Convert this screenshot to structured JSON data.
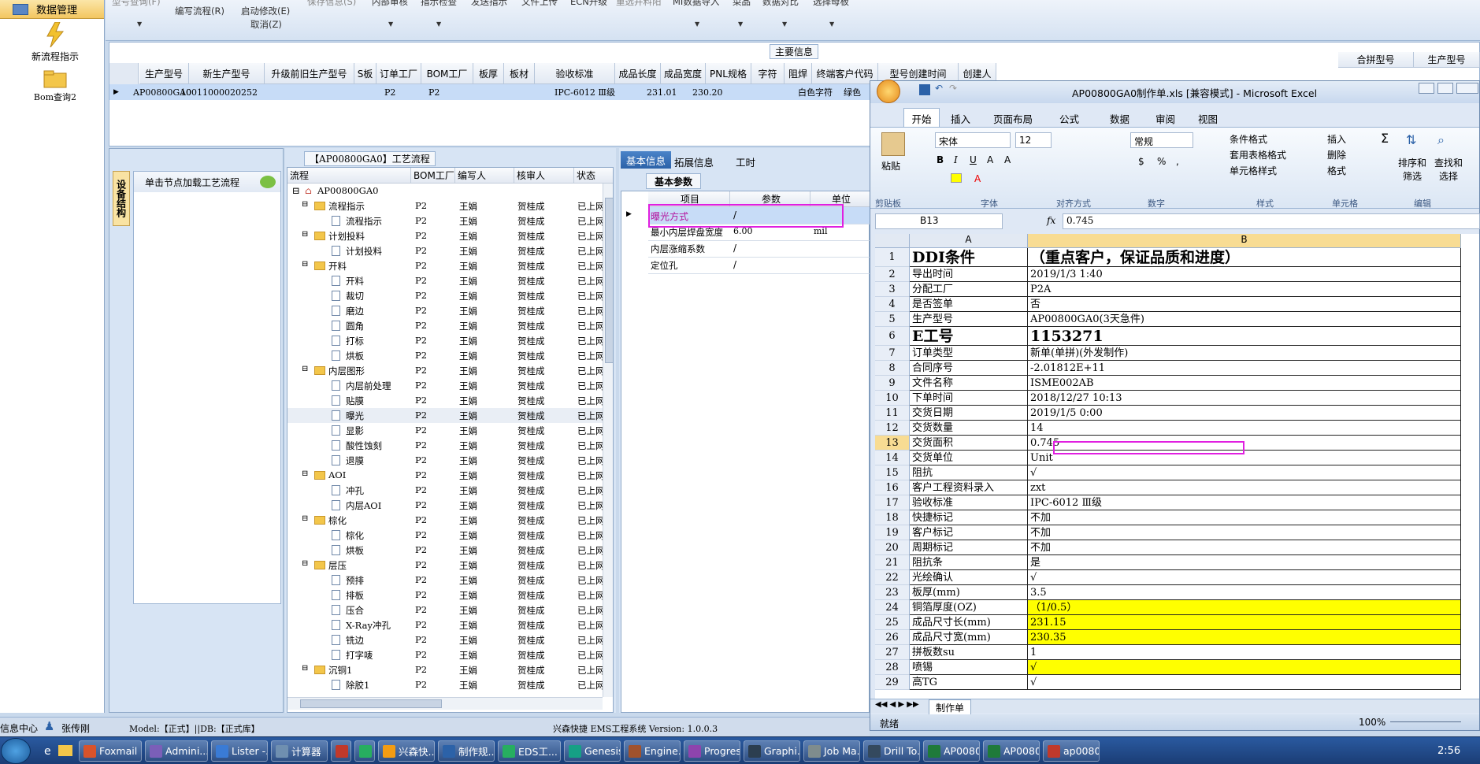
{
  "sidebar": {
    "header": "数据管理",
    "new_flow": "新流程指示",
    "bom_query": "Bom查询2"
  },
  "toolbar": {
    "model_query": "型号查询(F)",
    "edit_flow": "编写流程(R)",
    "start_modify": "启动修改(E)",
    "cancel": "取消(Z)",
    "save_info": "保存信息(S)",
    "internal_review": "内部审核",
    "instruction_check": "指示检查",
    "send_instruction": "发送指示",
    "file_upload": "文件上传",
    "ecn_upgrade": "ECN升级",
    "redo_merge": "重选并料阳",
    "mi_export": "MI数据导入",
    "set_tool": "菜品",
    "data_compare": "数据对比",
    "select_board": "选择母板"
  },
  "main_info": {
    "title": "主要信息",
    "columns": [
      "生产型号",
      "新生产型号",
      "升级前旧生产型号",
      "S板",
      "订单工厂",
      "BOM工厂",
      "板厚",
      "板材",
      "验收标准",
      "成品长度",
      "成品宽度",
      "PNL规格",
      "字符",
      "阻焊",
      "终端客户代码",
      "型号创建时间",
      "创建人"
    ],
    "extra_columns": [
      "合拼型号",
      "生产型号"
    ],
    "row": {
      "model": "AP00800GA0",
      "new_model": "10011000020252",
      "order_factory": "P2",
      "bom_factory": "P2",
      "standard": "IPC-6012 Ⅲ级",
      "length": "231.01",
      "width": "230.20",
      "char": "白色字符",
      "solder": "绿色"
    }
  },
  "left_panel": {
    "vertical_tab": "设备结构",
    "button": "单击节点加载工艺流程"
  },
  "process": {
    "title": "【AP00800GA0】工艺流程",
    "columns": [
      "流程",
      "BOM工厂",
      "编写人",
      "核审人",
      "状态"
    ],
    "root": "AP00800GA0",
    "rows": [
      {
        "name": "流程指示",
        "type": "folder",
        "f": "P2",
        "w": "王娟",
        "r": "贺桂成",
        "s": "已上网"
      },
      {
        "name": "流程指示",
        "type": "doc",
        "f": "P2",
        "w": "王娟",
        "r": "贺桂成",
        "s": "已上网"
      },
      {
        "name": "计划投料",
        "type": "folder",
        "f": "P2",
        "w": "王娟",
        "r": "贺桂成",
        "s": "已上网"
      },
      {
        "name": "计划投料",
        "type": "doc",
        "f": "P2",
        "w": "王娟",
        "r": "贺桂成",
        "s": "已上网"
      },
      {
        "name": "开料",
        "type": "folder",
        "f": "P2",
        "w": "王娟",
        "r": "贺桂成",
        "s": "已上网"
      },
      {
        "name": "开料",
        "type": "doc",
        "f": "P2",
        "w": "王娟",
        "r": "贺桂成",
        "s": "已上网"
      },
      {
        "name": "裁切",
        "type": "doc",
        "f": "P2",
        "w": "王娟",
        "r": "贺桂成",
        "s": "已上网"
      },
      {
        "name": "磨边",
        "type": "doc",
        "f": "P2",
        "w": "王娟",
        "r": "贺桂成",
        "s": "已上网"
      },
      {
        "name": "圆角",
        "type": "doc",
        "f": "P2",
        "w": "王娟",
        "r": "贺桂成",
        "s": "已上网"
      },
      {
        "name": "打标",
        "type": "doc",
        "f": "P2",
        "w": "王娟",
        "r": "贺桂成",
        "s": "已上网"
      },
      {
        "name": "烘板",
        "type": "doc",
        "f": "P2",
        "w": "王娟",
        "r": "贺桂成",
        "s": "已上网"
      },
      {
        "name": "内层图形",
        "type": "folder",
        "f": "P2",
        "w": "王娟",
        "r": "贺桂成",
        "s": "已上网"
      },
      {
        "name": "内层前处理",
        "type": "doc",
        "f": "P2",
        "w": "王娟",
        "r": "贺桂成",
        "s": "已上网"
      },
      {
        "name": "贴膜",
        "type": "doc",
        "f": "P2",
        "w": "王娟",
        "r": "贺桂成",
        "s": "已上网"
      },
      {
        "name": "曝光",
        "type": "doc",
        "f": "P2",
        "w": "王娟",
        "r": "贺桂成",
        "s": "已上网"
      },
      {
        "name": "显影",
        "type": "doc",
        "f": "P2",
        "w": "王娟",
        "r": "贺桂成",
        "s": "已上网"
      },
      {
        "name": "酸性蚀刻",
        "type": "doc",
        "f": "P2",
        "w": "王娟",
        "r": "贺桂成",
        "s": "已上网"
      },
      {
        "name": "退膜",
        "type": "doc",
        "f": "P2",
        "w": "王娟",
        "r": "贺桂成",
        "s": "已上网"
      },
      {
        "name": "AOI",
        "type": "folder",
        "f": "P2",
        "w": "王娟",
        "r": "贺桂成",
        "s": "已上网"
      },
      {
        "name": "冲孔",
        "type": "doc",
        "f": "P2",
        "w": "王娟",
        "r": "贺桂成",
        "s": "已上网"
      },
      {
        "name": "内层AOI",
        "type": "doc",
        "f": "P2",
        "w": "王娟",
        "r": "贺桂成",
        "s": "已上网"
      },
      {
        "name": "棕化",
        "type": "folder",
        "f": "P2",
        "w": "王娟",
        "r": "贺桂成",
        "s": "已上网"
      },
      {
        "name": "棕化",
        "type": "doc",
        "f": "P2",
        "w": "王娟",
        "r": "贺桂成",
        "s": "已上网"
      },
      {
        "name": "烘板",
        "type": "doc",
        "f": "P2",
        "w": "王娟",
        "r": "贺桂成",
        "s": "已上网"
      },
      {
        "name": "层压",
        "type": "folder",
        "f": "P2",
        "w": "王娟",
        "r": "贺桂成",
        "s": "已上网"
      },
      {
        "name": "预排",
        "type": "doc",
        "f": "P2",
        "w": "王娟",
        "r": "贺桂成",
        "s": "已上网"
      },
      {
        "name": "排板",
        "type": "doc",
        "f": "P2",
        "w": "王娟",
        "r": "贺桂成",
        "s": "已上网"
      },
      {
        "name": "压合",
        "type": "doc",
        "f": "P2",
        "w": "王娟",
        "r": "贺桂成",
        "s": "已上网"
      },
      {
        "name": "X-Ray冲孔",
        "type": "doc",
        "f": "P2",
        "w": "王娟",
        "r": "贺桂成",
        "s": "已上网"
      },
      {
        "name": "铣边",
        "type": "doc",
        "f": "P2",
        "w": "王娟",
        "r": "贺桂成",
        "s": "已上网"
      },
      {
        "name": "打字唛",
        "type": "doc",
        "f": "P2",
        "w": "王娟",
        "r": "贺桂成",
        "s": "已上网"
      },
      {
        "name": "沉铜1",
        "type": "folder",
        "f": "P2",
        "w": "王娟",
        "r": "贺桂成",
        "s": "已上网"
      },
      {
        "name": "除胶1",
        "type": "doc",
        "f": "P2",
        "w": "王娟",
        "r": "贺桂成",
        "s": "已上网"
      }
    ]
  },
  "basic": {
    "tabs": [
      "基本信息",
      "拓展信息",
      "工时"
    ],
    "subtab": "基本参数",
    "columns": [
      "项目",
      "参数",
      "单位"
    ],
    "rows": [
      {
        "item": "曝光方式",
        "param": "/",
        "unit": ""
      },
      {
        "item": "最小内层焊盘宽度",
        "param": "6.00",
        "unit": "mil"
      },
      {
        "item": "内层涨缩系数",
        "param": "/",
        "unit": ""
      },
      {
        "item": "定位孔",
        "param": "/",
        "unit": ""
      }
    ]
  },
  "status_bar": {
    "left": "信息中心",
    "user": "张传刚",
    "model": "Model:【正式】||DB:【正式库】",
    "system": "兴森快捷 EMS工程系统 Version: 1.0.0.3"
  },
  "excel": {
    "title": "AP00800GA0制作单.xls [兼容模式] - Microsoft Excel",
    "tabs": [
      "开始",
      "插入",
      "页面布局",
      "公式",
      "数据",
      "审阅",
      "视图"
    ],
    "font_name": "宋体",
    "font_size": "12",
    "number_format": "常规",
    "groups": [
      "剪贴板",
      "字体",
      "对齐方式",
      "数字",
      "样式",
      "单元格",
      "编辑"
    ],
    "clip": {
      "paste": "粘贴"
    },
    "styles": [
      "条件格式",
      "套用表格格式",
      "单元格样式"
    ],
    "cells_btns": [
      "插入",
      "删除",
      "格式"
    ],
    "edit_btns": [
      "排序和筛选",
      "查找和选择"
    ],
    "name_box": "B13",
    "formula": "0.745",
    "col_a": "A",
    "col_b": "B",
    "rows": [
      {
        "n": "1",
        "a": "DDI条件",
        "b": "（重点客户，保证品质和进度）",
        "big": true
      },
      {
        "n": "2",
        "a": "导出时间",
        "b": "2019/1/3 1:40"
      },
      {
        "n": "3",
        "a": "分配工厂",
        "b": "P2A"
      },
      {
        "n": "4",
        "a": "是否签单",
        "b": "否"
      },
      {
        "n": "5",
        "a": "生产型号",
        "b": "AP00800GA0(3天急件)"
      },
      {
        "n": "6",
        "a": "E工号",
        "b": "1153271",
        "big": true
      },
      {
        "n": "7",
        "a": "订单类型",
        "b": "新单(单拼)(外发制作)"
      },
      {
        "n": "8",
        "a": "合同序号",
        "b": "-2.01812E+11"
      },
      {
        "n": "9",
        "a": "文件名称",
        "b": "ISME002AB"
      },
      {
        "n": "10",
        "a": "下单时间",
        "b": "2018/12/27 10:13"
      },
      {
        "n": "11",
        "a": "交货日期",
        "b": "2019/1/5 0:00"
      },
      {
        "n": "12",
        "a": "交货数量",
        "b": "14"
      },
      {
        "n": "13",
        "a": "交货面积",
        "b": "0.745",
        "sel": true
      },
      {
        "n": "14",
        "a": "交货单位",
        "b": "Unit"
      },
      {
        "n": "15",
        "a": "阻抗",
        "b": "√"
      },
      {
        "n": "16",
        "a": "客户工程资料录入",
        "b": "zxt"
      },
      {
        "n": "17",
        "a": "验收标准",
        "b": "IPC-6012 Ⅲ级"
      },
      {
        "n": "18",
        "a": "快捷标记",
        "b": "不加"
      },
      {
        "n": "19",
        "a": "客户标记",
        "b": "不加"
      },
      {
        "n": "20",
        "a": "周期标记",
        "b": "不加"
      },
      {
        "n": "21",
        "a": "阻抗条",
        "b": "是"
      },
      {
        "n": "22",
        "a": "光绘确认",
        "b": "√"
      },
      {
        "n": "23",
        "a": "板厚(mm)",
        "b": "3.5"
      },
      {
        "n": "24",
        "a": "铜箔厚度(OZ)",
        "b": "（1/0.5）",
        "yellow": true
      },
      {
        "n": "25",
        "a": "成品尺寸长(mm)",
        "b": "231.15",
        "yellow": true
      },
      {
        "n": "26",
        "a": "成品尺寸宽(mm)",
        "b": "230.35",
        "yellow": true
      },
      {
        "n": "27",
        "a": "拼板数su",
        "b": "1"
      },
      {
        "n": "28",
        "a": "喷锡",
        "b": "√",
        "yellow": true
      },
      {
        "n": "29",
        "a": "高TG",
        "b": "√"
      }
    ],
    "sheet_tab": "制作单",
    "status": "就绪",
    "zoom": "100%"
  },
  "taskbar": {
    "items": [
      "Foxmail",
      "Admini...",
      "Lister -...",
      "计算器",
      "",
      "",
      "兴森快...",
      "制作规...",
      "EDS工...",
      "Genesis",
      "Engine...",
      "Progress",
      "Graphi...",
      "Job Ma...",
      "Drill To...",
      "AP0080...",
      "AP0080...",
      "ap0080..."
    ],
    "clock": "2:56"
  }
}
